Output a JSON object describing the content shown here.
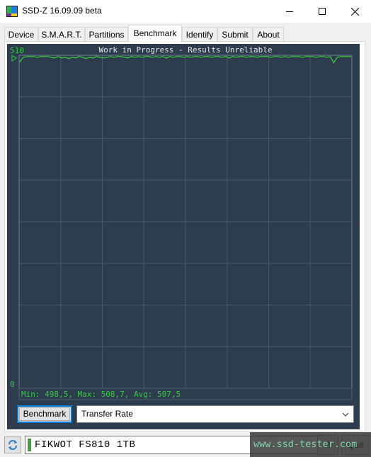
{
  "window": {
    "title": "SSD-Z 16.09.09 beta",
    "controls": [
      "minimize",
      "maximize",
      "close"
    ]
  },
  "tabs": [
    {
      "label": "Device",
      "active": false
    },
    {
      "label": "S.M.A.R.T.",
      "active": false
    },
    {
      "label": "Partitions",
      "active": false
    },
    {
      "label": "Benchmark",
      "active": true
    },
    {
      "label": "Identify",
      "active": false
    },
    {
      "label": "Submit",
      "active": false
    },
    {
      "label": "About",
      "active": false
    }
  ],
  "benchmark": {
    "button_label": "Benchmark",
    "mode_select": {
      "selected": "Transfer Rate"
    }
  },
  "chart_data": {
    "type": "line",
    "title": "Work in Progress - Results Unreliable",
    "ylim": [
      0,
      510
    ],
    "y_tick_labels": {
      "top": "510",
      "bottom": "0"
    },
    "grid": true,
    "grid_columns": 8,
    "grid_rows": 8,
    "stats_text": "Min: 498,5, Max: 508,7, Avg: 507,5",
    "stats": {
      "min": 498.5,
      "max": 508.7,
      "avg": 507.5
    },
    "series": [
      {
        "name": "Transfer Rate",
        "color": "#33d633",
        "values": [
          500,
          507,
          508,
          508,
          508,
          507,
          508,
          508,
          508,
          507,
          506,
          508,
          506,
          507,
          505,
          507,
          506,
          508,
          507,
          505,
          507,
          506,
          508,
          507,
          506,
          507,
          508,
          507,
          508,
          508,
          507,
          506,
          508,
          507,
          508,
          507,
          508,
          508,
          507,
          508,
          507,
          508,
          506,
          508,
          507,
          508,
          508,
          507,
          508,
          507,
          508,
          508,
          507,
          508,
          508,
          507,
          508,
          508,
          507,
          508,
          506,
          508,
          507,
          508,
          508,
          507,
          508,
          508,
          507,
          508,
          508,
          508,
          507,
          508,
          508,
          507,
          508,
          507,
          508,
          508,
          508,
          507,
          508,
          508,
          508,
          507,
          508,
          508,
          507,
          508,
          498.5,
          507,
          508,
          508,
          508,
          508
        ]
      }
    ]
  },
  "footer": {
    "drive_name": "FIKWOT FS810 1TB",
    "help_label": "?",
    "quit_label": "Quit",
    "watermark": "www.ssd-tester.com"
  },
  "colors": {
    "panel_bg": "#2e3d4d",
    "plot_line": "#33d633",
    "label_green": "#2ecc40",
    "grid": "#46586b",
    "accent": "#0078d7"
  }
}
